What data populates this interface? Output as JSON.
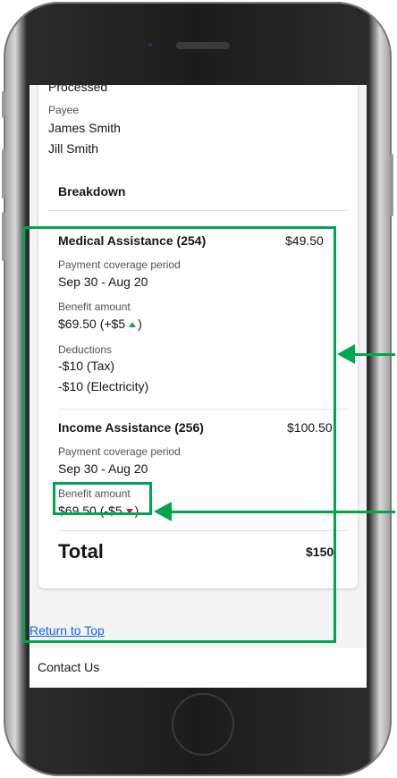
{
  "status_partial": "Processed",
  "payee": {
    "label": "Payee",
    "names": [
      "James Smith",
      "Jill Smith"
    ]
  },
  "breakdown": {
    "title": "Breakdown",
    "items": [
      {
        "name": "Medical Assistance (254)",
        "amount": "$49.50",
        "coverage_label": "Payment coverage period",
        "coverage_value": "Sep 30 - Aug 20",
        "benefit_label": "Benefit amount",
        "benefit_value": "$69.50 (+$5",
        "benefit_close": ")",
        "change_direction": "up",
        "deductions_label": "Deductions",
        "deductions": [
          "-$10 (Tax)",
          "-$10 (Electricity)"
        ]
      },
      {
        "name": "Income Assistance (256)",
        "amount": "$100.50",
        "coverage_label": "Payment coverage period",
        "coverage_value": "Sep 30 - Aug 20",
        "benefit_label": "Benefit amount",
        "benefit_value": "$69.50 (-$5",
        "benefit_close": ")",
        "change_direction": "down"
      }
    ],
    "total_label": "Total",
    "total_value": "$150"
  },
  "return_to_top": "Return to Top",
  "footer": {
    "contact_us": "Contact Us"
  },
  "colors": {
    "annotation": "#00a64f",
    "increase": "#24a148",
    "decrease": "#da1e28",
    "link": "#0f62fe"
  },
  "icons": {
    "increase": "triangle-up-icon",
    "decrease": "triangle-down-icon"
  }
}
